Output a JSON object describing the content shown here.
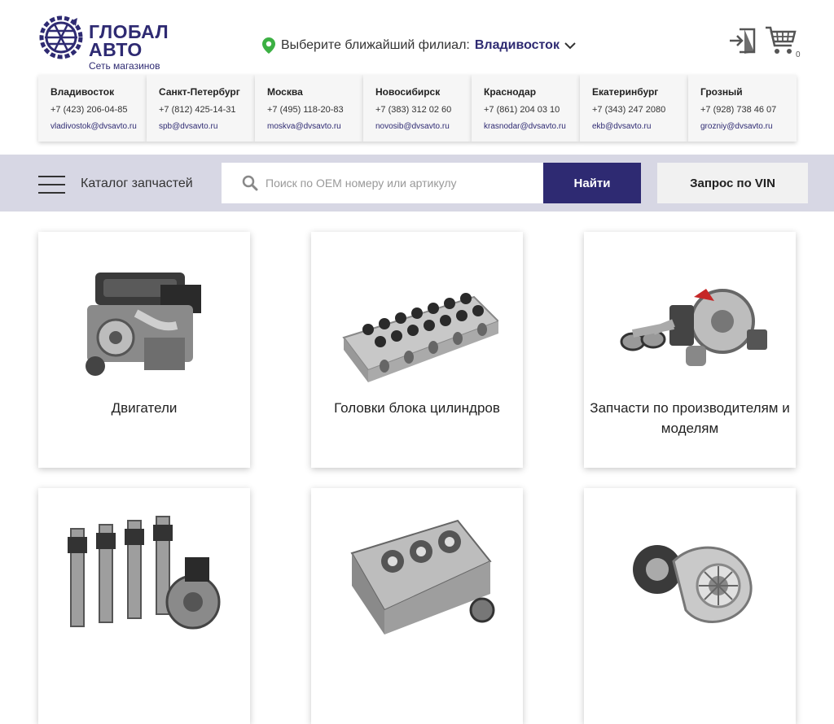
{
  "brand": {
    "name_line1": "ГЛОБАЛ",
    "name_line2": "АВТО",
    "tagline": "Сеть магазинов"
  },
  "branch": {
    "prompt": "Выберите ближайший филиал:",
    "city": "Владивосток"
  },
  "cart": {
    "count": "0"
  },
  "contacts": [
    {
      "city": "Владивосток",
      "phone": "+7 (423) 206-04-85",
      "email": "vladivostok@dvsavto.ru"
    },
    {
      "city": "Санкт-Петербург",
      "phone": "+7 (812) 425-14-31",
      "email": "spb@dvsavto.ru"
    },
    {
      "city": "Москва",
      "phone": "+7 (495) 118-20-83",
      "email": "moskva@dvsavto.ru"
    },
    {
      "city": "Новосибирск",
      "phone": "+7 (383) 312 02 60",
      "email": "novosib@dvsavto.ru"
    },
    {
      "city": "Краснодар",
      "phone": "+7 (861) 204 03 10",
      "email": "krasnodar@dvsavto.ru"
    },
    {
      "city": "Екатеринбург",
      "phone": "+7 (343) 247 2080",
      "email": "ekb@dvsavto.ru"
    },
    {
      "city": "Грозный",
      "phone": "+7 (928) 738 46 07",
      "email": "grozniy@dvsavto.ru"
    }
  ],
  "toolbar": {
    "catalog_label": "Каталог запчастей",
    "search_placeholder": "Поиск по OEM номеру или артикулу",
    "search_value": "",
    "find_label": "Найти",
    "vin_label": "Запрос по VIN"
  },
  "categories": [
    {
      "label": "Двигатели",
      "icon": "engine-image"
    },
    {
      "label": "Головки блока цилиндров",
      "icon": "cylinder-head-image"
    },
    {
      "label": "Запчасти по производителям и моделям",
      "icon": "parts-image"
    },
    {
      "label": "",
      "icon": "injectors-image"
    },
    {
      "label": "",
      "icon": "transmission-image"
    },
    {
      "label": "",
      "icon": "turbocharger-image"
    }
  ],
  "colors": {
    "brand": "#2e2a72",
    "band": "#d7d7e4",
    "pin": "#3cb043"
  }
}
